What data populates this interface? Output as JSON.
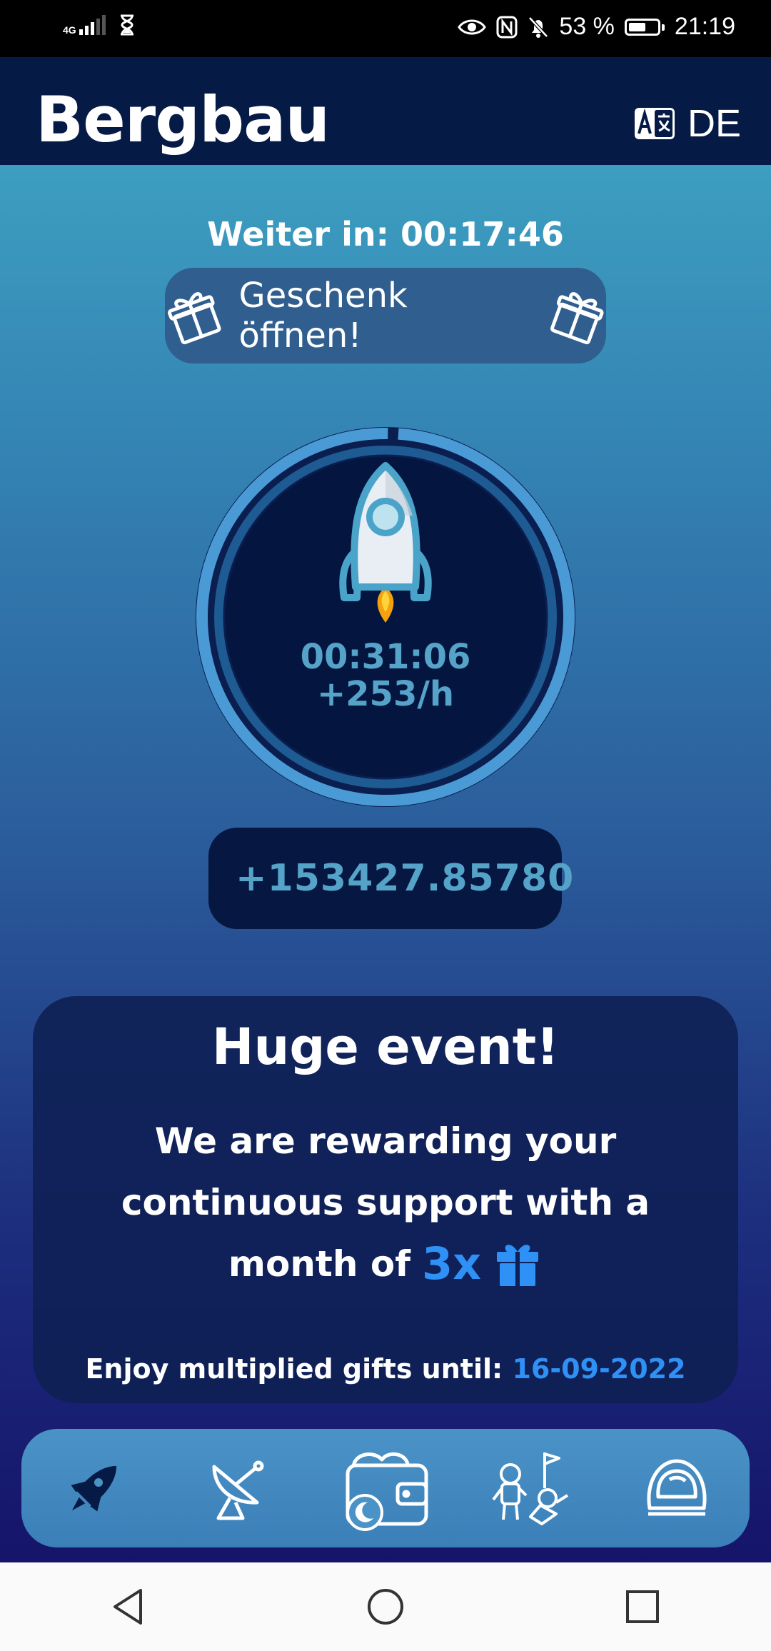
{
  "status_bar": {
    "network": "4G",
    "battery_percent": "53 %",
    "battery_level": 0.53,
    "time": "21:19",
    "icons": [
      "hourglass-icon",
      "eye-icon",
      "nfc-icon",
      "bell-off-icon",
      "battery-icon"
    ]
  },
  "header": {
    "title": "Bergbau",
    "language": "DE",
    "language_icon": "translate-icon"
  },
  "timer": {
    "label": "Weiter in: 00:17:46"
  },
  "gift_button": {
    "label": "Geschenk öffnen!",
    "icon": "gift-icon"
  },
  "mining": {
    "elapsed": "00:31:06",
    "rate": "+253/h",
    "icon": "rocket-icon"
  },
  "balance": {
    "value": "+153427.85780",
    "icon": "coin-rocket-icon"
  },
  "event": {
    "title": "Huge event!",
    "line1": "We are rewarding your",
    "line2": "continuous support with a",
    "line3_prefix": "month of",
    "multiplier": "3x",
    "footer_prefix": "Enjoy multiplied gifts until:",
    "footer_date": "16-09-2022"
  },
  "tabs": [
    {
      "name": "rocket-tab",
      "icon": "rocket-icon"
    },
    {
      "name": "satellite-tab",
      "icon": "satellite-dish-icon"
    },
    {
      "name": "wallet-tab",
      "icon": "wallet-icon"
    },
    {
      "name": "astronauts-tab",
      "icon": "astronauts-icon"
    },
    {
      "name": "helmet-tab",
      "icon": "helmet-icon"
    }
  ],
  "colors": {
    "header_bg": "#061a46",
    "accent_blue": "#2f90f5",
    "ring_blue": "#4a9ad6",
    "teal_text": "#55a3c8"
  }
}
